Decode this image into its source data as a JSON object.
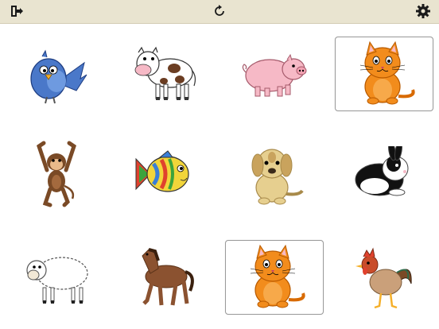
{
  "toolbar": {
    "exit_icon": "exit-door-icon",
    "reset_icon": "refresh-icon",
    "settings_icon": "gear-icon"
  },
  "cards": [
    {
      "animal": "bird",
      "selected": false
    },
    {
      "animal": "cow",
      "selected": false
    },
    {
      "animal": "pig",
      "selected": false
    },
    {
      "animal": "cat",
      "selected": true
    },
    {
      "animal": "monkey",
      "selected": false
    },
    {
      "animal": "fish",
      "selected": false
    },
    {
      "animal": "dog",
      "selected": false
    },
    {
      "animal": "rabbit",
      "selected": false
    },
    {
      "animal": "sheep",
      "selected": false
    },
    {
      "animal": "horse",
      "selected": false
    },
    {
      "animal": "cat",
      "selected": true
    },
    {
      "animal": "rooster",
      "selected": false
    }
  ],
  "colors": {
    "toolbar_bg": "#e9e4d0",
    "cat": "#f28c1c",
    "bird": "#4a78c9",
    "pig": "#f6b9c6",
    "horse": "#8b5230",
    "monkey": "#7a4a26",
    "dog": "#e6cf8f"
  }
}
